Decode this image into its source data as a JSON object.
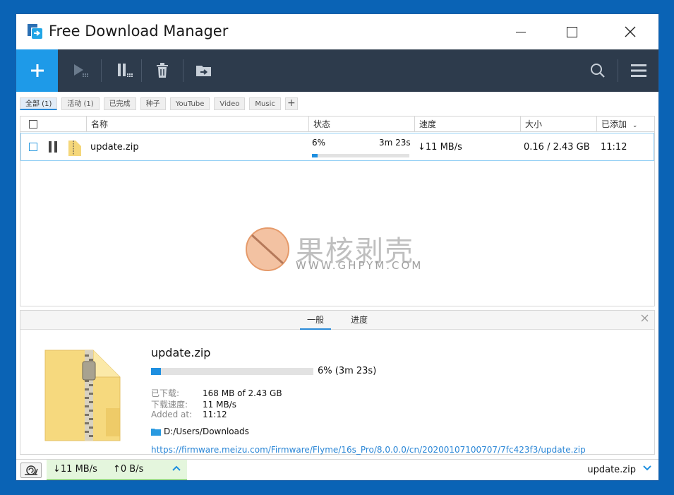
{
  "window": {
    "title": "Free Download Manager",
    "accent_color": "#1e9ae8",
    "toolbar_color": "#2d3b4c"
  },
  "toolbar": {
    "icons": [
      "add-icon",
      "resume-all-icon",
      "pause-all-icon",
      "delete-icon",
      "move-icon",
      "search-icon",
      "menu-icon"
    ]
  },
  "filters": [
    {
      "label": "全部 (1)",
      "active": true
    },
    {
      "label": "活动 (1)",
      "active": false
    },
    {
      "label": "已完成",
      "active": false
    },
    {
      "label": "种子",
      "active": false
    },
    {
      "label": "YouTube",
      "active": false
    },
    {
      "label": "Video",
      "active": false
    },
    {
      "label": "Music",
      "active": false
    }
  ],
  "table": {
    "headers": {
      "name": "名称",
      "status": "状态",
      "speed": "速度",
      "size": "大小",
      "added": "已添加"
    },
    "rows": [
      {
        "name": "update.zip",
        "percent": "6%",
        "eta": "3m 23s",
        "progress": 0.06,
        "speed": "↓11 MB/s",
        "size": "0.16 / 2.43 GB",
        "added": "11:12"
      }
    ]
  },
  "watermark": {
    "text_cn": "果核剥壳",
    "text_url": "WWW.GHPYM.COM"
  },
  "details": {
    "tabs": [
      "一般",
      "进度"
    ],
    "file_name": "update.zip",
    "progress": 0.06,
    "progress_text": "6% (3m 23s)",
    "downloaded_label": "已下载:",
    "downloaded_value": "168 MB of 2.43 GB",
    "speed_label": "下载速度:",
    "speed_value": "11 MB/s",
    "added_label": "Added at:",
    "added_value": "11:12",
    "folder": "D:/Users/Downloads",
    "url": "https://firmware.meizu.com/Firmware/Flyme/16s_Pro/8.0.0.0/cn/20200107100707/7fc423f3/update.zip"
  },
  "statusbar": {
    "down_speed": "↓11 MB/s",
    "up_speed": "↑0 B/s",
    "current_file": "update.zip"
  }
}
